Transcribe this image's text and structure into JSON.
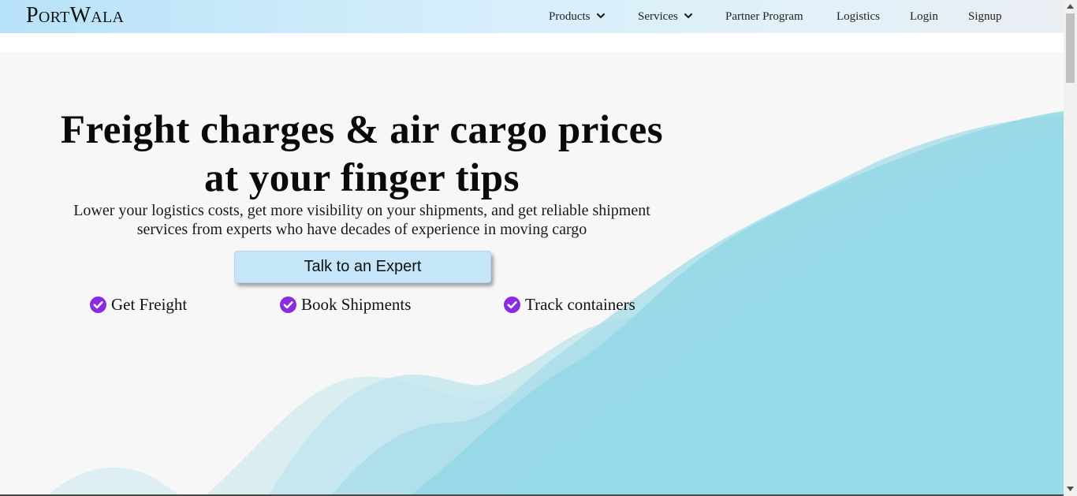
{
  "brand": {
    "logo_text": "PortWala"
  },
  "nav": {
    "products": "Products",
    "services": "Services",
    "partner_program": "Partner Program",
    "logistics": "Logistics",
    "login": "Login",
    "signup": "Signup"
  },
  "hero": {
    "headline_line1": "Freight charges & air cargo prices",
    "headline_line2": "at your finger tips",
    "subhead_line1": "Lower your logistics costs, get more visibility on your shipments, and get reliable shipment",
    "subhead_line2": "services from experts who have decades of experience in moving cargo",
    "cta_label": "Talk to an Expert"
  },
  "features": [
    {
      "label": "Get Freight",
      "icon": "check-circle-icon"
    },
    {
      "label": "Book Shipments",
      "icon": "check-circle-icon"
    },
    {
      "label": "Track containers",
      "icon": "check-circle-icon"
    }
  ],
  "colors": {
    "navbar_start": "#b8e2f8",
    "navbar_end": "#e9eef2",
    "check_purple": "#8a2be2",
    "cta_bg": "#c4e6f8",
    "wave_teal": "#94dbe8"
  }
}
